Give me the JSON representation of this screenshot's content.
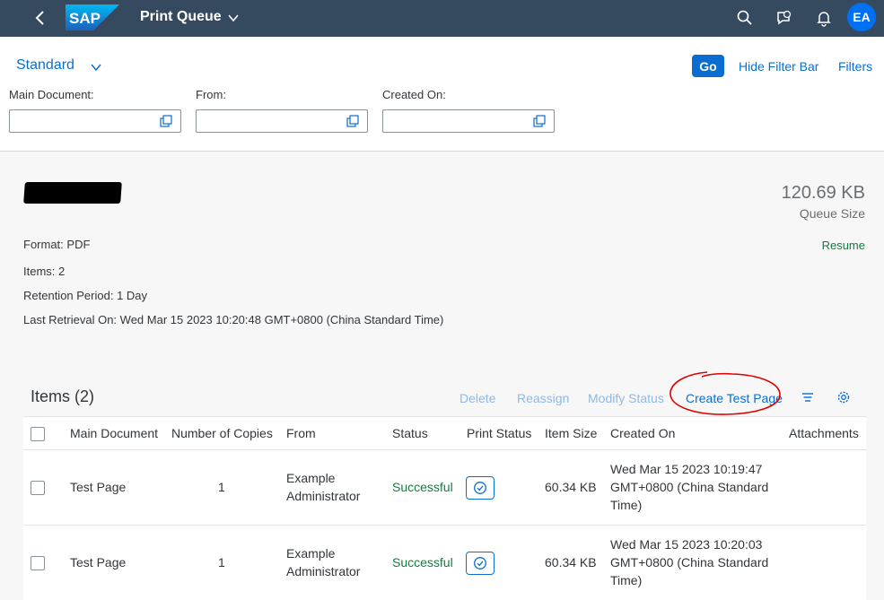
{
  "shell": {
    "logo_text": "SAP",
    "title": "Print Queue",
    "avatar_initials": "EA",
    "icons": [
      "back-arrow-icon",
      "search-icon",
      "feedback-icon",
      "notifications-icon"
    ]
  },
  "filterbar": {
    "variant": "Standard",
    "go_label": "Go",
    "hide_label": "Hide Filter Bar",
    "filters_label": "Filters",
    "fields": [
      {
        "label": "Main Document:",
        "value": ""
      },
      {
        "label": "From:",
        "value": ""
      },
      {
        "label": "Created On:",
        "value": ""
      }
    ]
  },
  "header": {
    "queue_size": "120.69 KB",
    "queue_size_label": "Queue Size",
    "resume_label": "Resume",
    "attributes": [
      "Format: PDF",
      "Items: 2",
      "Retention Period: 1 Day",
      "Last Retrieval On: Wed Mar 15 2023 10:20:48 GMT+0800 (China Standard Time)"
    ]
  },
  "table": {
    "title": "Items (2)",
    "toolbar": {
      "delete": "Delete",
      "reassign": "Reassign",
      "modify_status": "Modify Status",
      "create_test_page": "Create Test Page"
    },
    "columns": [
      "Main Document",
      "Number of Copies",
      "From",
      "Status",
      "Print Status",
      "Item Size",
      "Created On",
      "Attachments"
    ],
    "rows": [
      {
        "main_document": "Test Page",
        "copies": "1",
        "from_line1": "Example",
        "from_line2": "Administrator",
        "status": "Successful",
        "item_size": "60.34 KB",
        "created_line1": "Wed Mar 15 2023 10:19:47",
        "created_line2": "GMT+0800 (China Standard",
        "created_line3": "Time)"
      },
      {
        "main_document": "Test Page",
        "copies": "1",
        "from_line1": "Example",
        "from_line2": "Administrator",
        "status": "Successful",
        "item_size": "60.34 KB",
        "created_line1": "Wed Mar 15 2023 10:20:03",
        "created_line2": "GMT+0800 (China Standard",
        "created_line3": "Time)"
      }
    ]
  },
  "colors": {
    "shell_bg": "#354a5f",
    "accent": "#0a6ed1",
    "success": "#107e3e",
    "annotation": "#e00000"
  }
}
